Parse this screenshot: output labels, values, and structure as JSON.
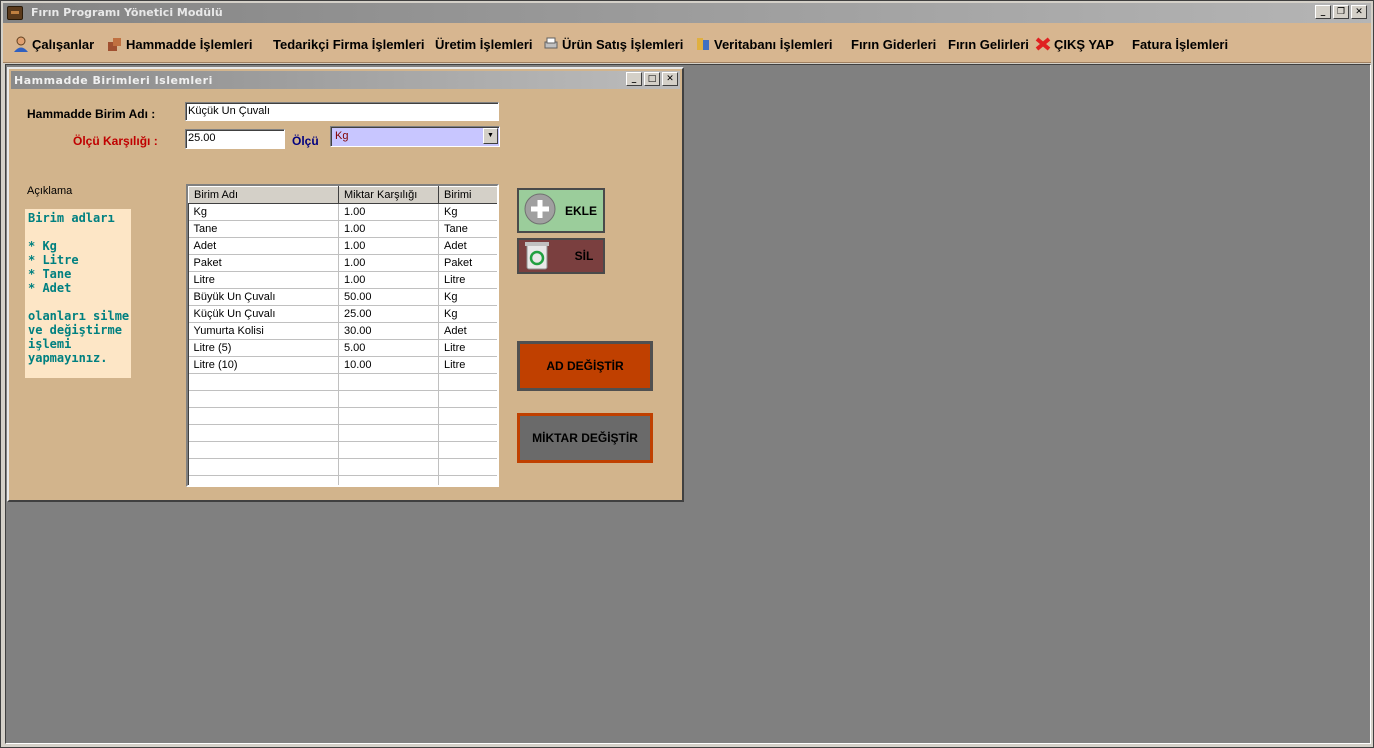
{
  "window": {
    "title": "Fırın Programı Yönetici Modülü"
  },
  "menu": [
    {
      "label": "Çalışanlar",
      "icon": "person-icon"
    },
    {
      "label": "Hammadde  İşlemleri",
      "icon": "boxes-icon"
    },
    {
      "label": "Tedarikçi Firma İşlemleri",
      "icon": ""
    },
    {
      "label": "Üretim İşlemleri",
      "icon": ""
    },
    {
      "label": "Ürün Satış İşlemleri",
      "icon": "printer-icon"
    },
    {
      "label": "Veritabanı İşlemleri",
      "icon": "database-icon"
    },
    {
      "label": "Fırın Giderleri",
      "icon": ""
    },
    {
      "label": "Fırın Gelirleri",
      "icon": ""
    },
    {
      "label": "ÇIKŞ YAP",
      "icon": "red-x-icon"
    },
    {
      "label": "Fatura İşlemleri",
      "icon": ""
    }
  ],
  "child": {
    "title": "Hammadde  Birimleri  Islemleri",
    "birim_adi_label": "Hammadde Birim Adı :",
    "birim_adi_value": "Küçük Un Çuvalı",
    "olcu_karsiligi_label": "Ölçü  Karşılığı :",
    "olcu_karsiligi_value": "25.00",
    "olcu_label": "Ölçü",
    "olcu_value": "Kg",
    "aciklama_label": "Açıklama",
    "note": "Birim adları\n\n* Kg\n* Litre\n* Tane\n* Adet\n\nolanları silme\nve değiştirme\nişlemi\nyapmayınız."
  },
  "table": {
    "columns": [
      "Birim Adı",
      "Miktar Karşılığı",
      "Birimi"
    ],
    "rows": [
      [
        "Kg",
        "1.00",
        "Kg"
      ],
      [
        "Tane",
        "1.00",
        "Tane"
      ],
      [
        "Adet",
        "1.00",
        "Adet"
      ],
      [
        "Paket",
        "1.00",
        "Paket"
      ],
      [
        "Litre",
        "1.00",
        "Litre"
      ],
      [
        "Büyük Un Çuvalı",
        "50.00",
        "Kg"
      ],
      [
        "Küçük Un Çuvalı",
        "25.00",
        "Kg"
      ],
      [
        "Yumurta Kolisi",
        "30.00",
        "Adet"
      ],
      [
        "Litre (5)",
        "5.00",
        "Litre"
      ],
      [
        "Litre (10)",
        "10.00",
        "Litre"
      ],
      [
        "",
        "",
        ""
      ],
      [
        "",
        "",
        ""
      ],
      [
        "",
        "",
        ""
      ],
      [
        "",
        "",
        ""
      ],
      [
        "",
        "",
        ""
      ],
      [
        "",
        "",
        ""
      ],
      [
        "",
        "",
        ""
      ]
    ]
  },
  "buttons": {
    "ekle": "EKLE",
    "sil": "SİL",
    "ad_degistir": "AD DEĞİŞTİR",
    "miktar_degistir": "MİKTAR DEĞİŞTİR"
  },
  "colors": {
    "menubar_bg": "#d7b690",
    "form_bg": "#d2b48c",
    "label_red": "#c00000",
    "label_blue": "#000080",
    "note_text": "#008080"
  }
}
